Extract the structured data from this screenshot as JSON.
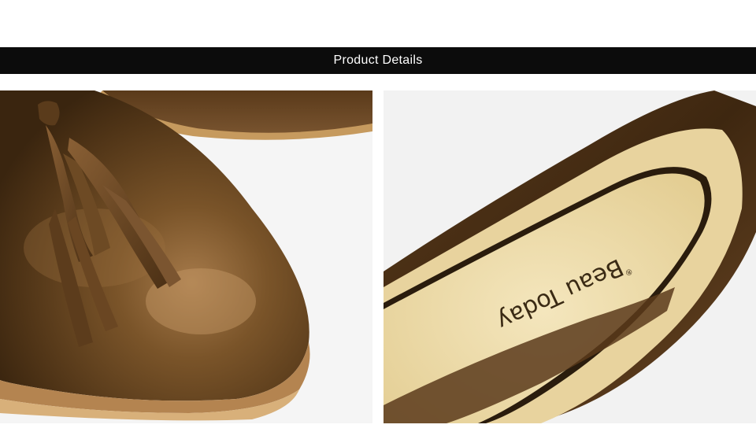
{
  "banner": {
    "title": "Product Details"
  },
  "photos": [
    {
      "subject": "close-up of brown leather tassel loafer toe"
    },
    {
      "subject": "close-up of loafer insole with brand print",
      "insole_brand": "Beau Today",
      "insole_mark": "®"
    }
  ],
  "colors": {
    "banner_bg": "#0c0c0c",
    "banner_text": "#ffffff",
    "leather": "#6b4a26",
    "insole": "#efe0b4"
  }
}
